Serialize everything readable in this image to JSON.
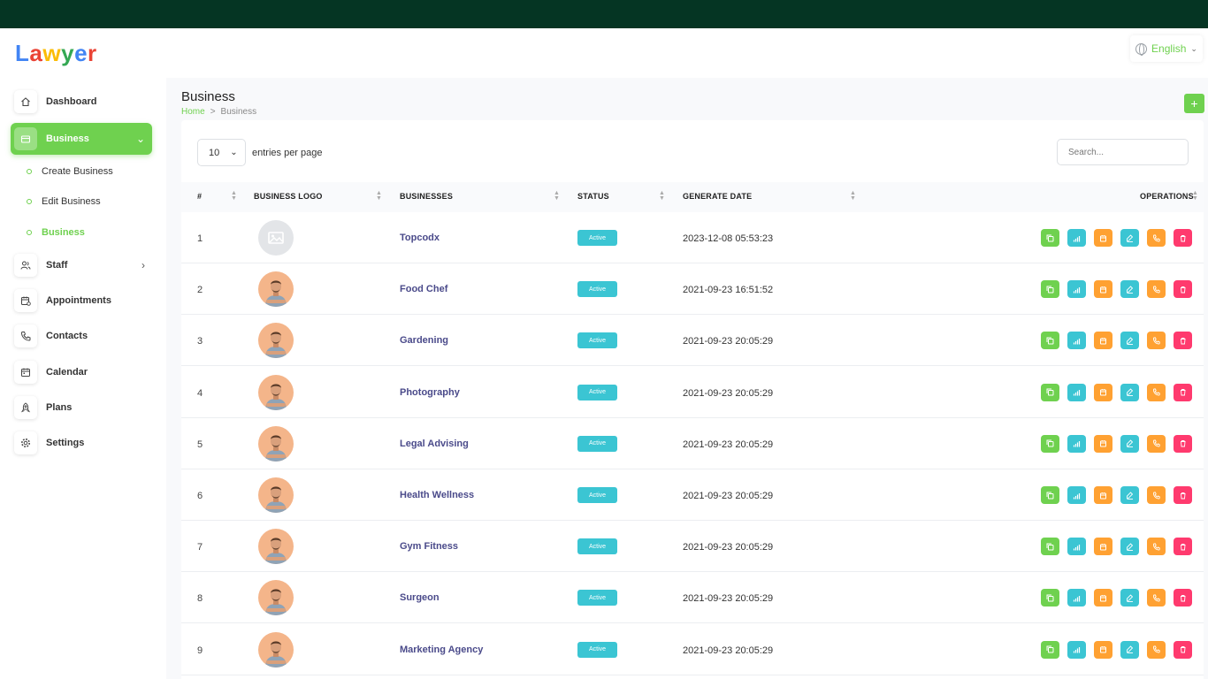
{
  "app": {
    "logo_letters": [
      {
        "char": "L",
        "color": "#4285f4"
      },
      {
        "char": "a",
        "color": "#ea4335"
      },
      {
        "char": "w",
        "color": "#fbbc05"
      },
      {
        "char": "y",
        "color": "#34a853"
      },
      {
        "char": "e",
        "color": "#4285f4"
      },
      {
        "char": "r",
        "color": "#ea4335"
      }
    ],
    "language": "English",
    "colors": {
      "accent": "#6fd14f",
      "topbar": "#053523",
      "status": "#3bc5d3"
    }
  },
  "sidebar": {
    "items": [
      {
        "label": "Dashboard",
        "icon": "home-icon"
      },
      {
        "label": "Business",
        "icon": "business-icon",
        "active": true
      },
      {
        "label": "Staff",
        "icon": "users-icon"
      },
      {
        "label": "Appointments",
        "icon": "calendar-check-icon"
      },
      {
        "label": "Contacts",
        "icon": "phone-icon"
      },
      {
        "label": "Calendar",
        "icon": "calendar-icon"
      },
      {
        "label": "Plans",
        "icon": "rocket-icon"
      },
      {
        "label": "Settings",
        "icon": "gear-icon"
      }
    ],
    "business_sub": [
      {
        "label": "Create Business"
      },
      {
        "label": "Edit Business"
      },
      {
        "label": "Business",
        "active": true
      }
    ]
  },
  "page": {
    "title": "Business",
    "breadcrumb": {
      "home": "Home",
      "sep": ">",
      "current": "Business"
    },
    "add_label": "+"
  },
  "table": {
    "per_page": "10",
    "per_page_label": "entries per page",
    "search_placeholder": "Search...",
    "headers": {
      "num": "#",
      "logo": "BUSINESS LOGO",
      "business": "BUSINESSES",
      "status": "STATUS",
      "date": "GENERATE DATE",
      "ops": "OPERATIONS"
    },
    "rows": [
      {
        "num": "1",
        "name": "Topcodx",
        "status": "Active",
        "date": "2023-12-08 05:53:23",
        "logo": "placeholder"
      },
      {
        "num": "2",
        "name": "Food Chef",
        "status": "Active",
        "date": "2021-09-23 16:51:52",
        "logo": "person"
      },
      {
        "num": "3",
        "name": "Gardening",
        "status": "Active",
        "date": "2021-09-23 20:05:29",
        "logo": "person"
      },
      {
        "num": "4",
        "name": "Photography",
        "status": "Active",
        "date": "2021-09-23 20:05:29",
        "logo": "person"
      },
      {
        "num": "5",
        "name": "Legal Advising",
        "status": "Active",
        "date": "2021-09-23 20:05:29",
        "logo": "person"
      },
      {
        "num": "6",
        "name": "Health Wellness",
        "status": "Active",
        "date": "2021-09-23 20:05:29",
        "logo": "person"
      },
      {
        "num": "7",
        "name": "Gym Fitness",
        "status": "Active",
        "date": "2021-09-23 20:05:29",
        "logo": "person"
      },
      {
        "num": "8",
        "name": "Surgeon",
        "status": "Active",
        "date": "2021-09-23 20:05:29",
        "logo": "person"
      },
      {
        "num": "9",
        "name": "Marketing Agency",
        "status": "Active",
        "date": "2021-09-23 20:05:29",
        "logo": "person"
      }
    ],
    "operations": [
      {
        "name": "copy-icon",
        "color": "#6fd14f"
      },
      {
        "name": "analytics-icon",
        "color": "#3bc5d3"
      },
      {
        "name": "calendar-icon",
        "color": "#ffa132"
      },
      {
        "name": "edit-icon",
        "color": "#3bc5d3"
      },
      {
        "name": "phone-icon",
        "color": "#ffa132"
      },
      {
        "name": "trash-icon",
        "color": "#ff3a6e"
      }
    ]
  }
}
